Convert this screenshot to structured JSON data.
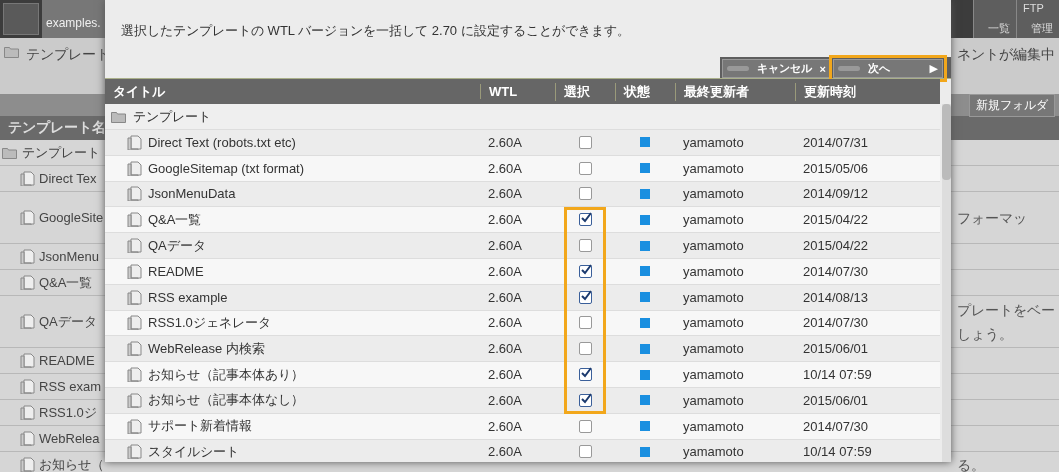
{
  "app": {
    "site_tab": "examples.",
    "header_tabs": [
      {
        "label": "一覧"
      },
      {
        "label_top": "FTP",
        "label": "管理"
      }
    ],
    "breadcrumb": "テンプレート",
    "notice": "ネントが編集中",
    "new_folder_button": "新規フォルダ",
    "column_header": "テンプレート名",
    "rows": [
      {
        "kind": "folder",
        "name": "テンプレート",
        "note": "",
        "tall": false
      },
      {
        "kind": "file",
        "name": "Direct Tex",
        "note": "",
        "tall": false
      },
      {
        "kind": "file",
        "name": "GoogleSite",
        "note": "フォーマッ",
        "tall": true
      },
      {
        "kind": "file",
        "name": "JsonMenu",
        "note": "",
        "tall": false
      },
      {
        "kind": "file",
        "name": "Q&A一覧",
        "note": "",
        "tall": false
      },
      {
        "kind": "file",
        "name": "QAデータ",
        "note": [
          "プレートをベー",
          "しょう。"
        ],
        "tall": true
      },
      {
        "kind": "file",
        "name": "README",
        "note": "",
        "tall": false
      },
      {
        "kind": "file",
        "name": "RSS exam",
        "note": "",
        "tall": false
      },
      {
        "kind": "file",
        "name": "RSS1.0ジ",
        "note": "",
        "tall": false
      },
      {
        "kind": "file",
        "name": "WebRelea",
        "note": "",
        "tall": false
      },
      {
        "kind": "file",
        "name": "お知らせ（",
        "note": "る。",
        "tall": false
      }
    ]
  },
  "dialog": {
    "message": "選択したテンプレートの WTL バージョンを一括して 2.70 に設定することができます。",
    "buttons": [
      {
        "label": "キャンセル",
        "icon": "×",
        "highlighted": false
      },
      {
        "label": "次へ",
        "icon": "▶",
        "highlighted": true
      }
    ],
    "columns": [
      "タイトル",
      "WTL",
      "選択",
      "状態",
      "最終更新者",
      "更新時刻"
    ],
    "folder": "テンプレート",
    "rows": [
      {
        "title": "Direct Text (robots.txt etc)",
        "wtl": "2.60A",
        "checked": false,
        "highlighted": false,
        "updater": "yamamoto",
        "updated": "2014/07/31"
      },
      {
        "title": "GoogleSitemap (txt format)",
        "wtl": "2.60A",
        "checked": false,
        "highlighted": false,
        "updater": "yamamoto",
        "updated": "2015/05/06"
      },
      {
        "title": "JsonMenuData",
        "wtl": "2.60A",
        "checked": false,
        "highlighted": false,
        "updater": "yamamoto",
        "updated": "2014/09/12"
      },
      {
        "title": "Q&A一覧",
        "wtl": "2.60A",
        "checked": true,
        "highlighted": true,
        "updater": "yamamoto",
        "updated": "2015/04/22"
      },
      {
        "title": "QAデータ",
        "wtl": "2.60A",
        "checked": false,
        "highlighted": true,
        "updater": "yamamoto",
        "updated": "2015/04/22"
      },
      {
        "title": "README",
        "wtl": "2.60A",
        "checked": true,
        "highlighted": true,
        "updater": "yamamoto",
        "updated": "2014/07/30"
      },
      {
        "title": "RSS example",
        "wtl": "2.60A",
        "checked": true,
        "highlighted": true,
        "updater": "yamamoto",
        "updated": "2014/08/13"
      },
      {
        "title": "RSS1.0ジェネレータ",
        "wtl": "2.60A",
        "checked": false,
        "highlighted": true,
        "updater": "yamamoto",
        "updated": "2014/07/30"
      },
      {
        "title": "WebRelease 内検索",
        "wtl": "2.60A",
        "checked": false,
        "highlighted": true,
        "updater": "yamamoto",
        "updated": "2015/06/01"
      },
      {
        "title": "お知らせ（記事本体あり）",
        "wtl": "2.60A",
        "checked": true,
        "highlighted": true,
        "updater": "yamamoto",
        "updated": "10/14 07:59"
      },
      {
        "title": "お知らせ（記事本体なし）",
        "wtl": "2.60A",
        "checked": true,
        "highlighted": true,
        "updater": "yamamoto",
        "updated": "2015/06/01"
      },
      {
        "title": "サポート新着情報",
        "wtl": "2.60A",
        "checked": false,
        "highlighted": false,
        "updater": "yamamoto",
        "updated": "2014/07/30"
      },
      {
        "title": "スタイルシート",
        "wtl": "2.60A",
        "checked": false,
        "highlighted": false,
        "updater": "yamamoto",
        "updated": "10/14 07:59"
      }
    ]
  }
}
